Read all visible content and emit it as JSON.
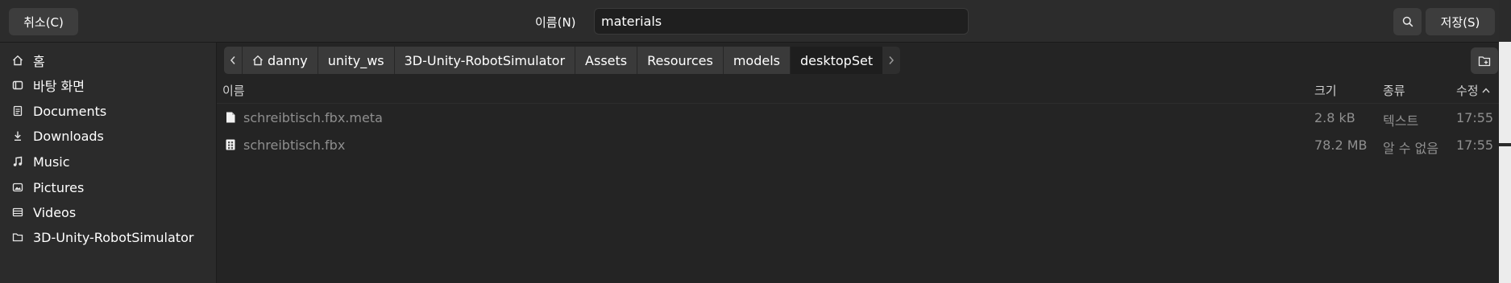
{
  "header": {
    "cancel_label": "취소(C)",
    "name_label": "이름(N)",
    "name_value": "materials",
    "save_label": "저장(S)"
  },
  "sidebar": {
    "items": [
      {
        "label": "홈",
        "icon": "home-icon"
      },
      {
        "label": "바탕 화면",
        "icon": "desktop-icon"
      },
      {
        "label": "Documents",
        "icon": "document-icon"
      },
      {
        "label": "Downloads",
        "icon": "download-icon"
      },
      {
        "label": "Music",
        "icon": "music-icon"
      },
      {
        "label": "Pictures",
        "icon": "picture-icon"
      },
      {
        "label": "Videos",
        "icon": "video-icon"
      },
      {
        "label": "3D-Unity-RobotSimulator",
        "icon": "folder-icon"
      }
    ]
  },
  "breadcrumb": {
    "items": [
      "danny",
      "unity_ws",
      "3D-Unity-RobotSimulator",
      "Assets",
      "Resources",
      "models",
      "desktopSet"
    ],
    "active": "desktopSet"
  },
  "columns": {
    "name": "이름",
    "size": "크기",
    "type": "종류",
    "modified": "수정"
  },
  "files": [
    {
      "name": "schreibtisch.fbx.meta",
      "size": "2.8 kB",
      "type": "텍스트",
      "modified": "17:55",
      "icon": "text-file-icon"
    },
    {
      "name": "schreibtisch.fbx",
      "size": "78.2 MB",
      "type": "알 수 없음",
      "modified": "17:55",
      "icon": "binary-file-icon"
    }
  ],
  "colors": {
    "background": "#242424",
    "sidebar": "#2b2b2b",
    "button": "#3d3d3d",
    "dim_text": "#8f8f8f"
  }
}
